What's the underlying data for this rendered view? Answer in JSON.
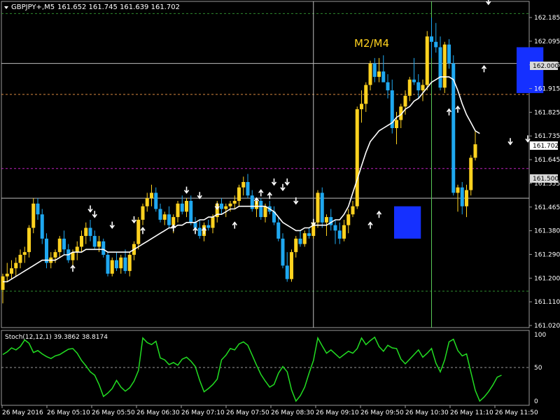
{
  "header": {
    "symbol": "GBPJPY+,M5",
    "ohlc": "161.652 161.745 161.639 161.702"
  },
  "colors": {
    "bull": "#ffd21f",
    "bear": "#1fa8f0",
    "ma": "#ffffff",
    "stoch": "#22dd22",
    "highlight": "#1530ff",
    "grid_green": "#2e8b2e",
    "grid_magenta": "#c020c0",
    "annotation": "#ffd21f"
  },
  "annotation": {
    "text": "M2/M4"
  },
  "price_labels": [
    "162.000",
    "161.702",
    "161.500"
  ],
  "stoch": {
    "title": "Stoch(12,12,1) 39.3862 38.8174",
    "ticks": [
      "100",
      "50",
      "0"
    ]
  },
  "chart_data": [
    {
      "type": "candlestick",
      "ylim": [
        161.02,
        162.23
      ],
      "y_ticks": [
        "162.185",
        "162.095",
        "162.005",
        "161.915",
        "161.825",
        "161.735",
        "161.645",
        "161.555",
        "161.465",
        "161.380",
        "161.290",
        "161.200",
        "161.110",
        "161.020"
      ],
      "x_ticks": [
        "26 May 2016",
        "26 May 05:10",
        "26 May 05:50",
        "26 May 06:30",
        "26 May 07:10",
        "26 May 07:50",
        "26 May 08:30",
        "26 May 09:10",
        "26 May 09:50",
        "26 May 10:30",
        "26 May 11:10",
        "26 May 11:50"
      ],
      "h_levels": [
        {
          "price": 162.185,
          "style": "dashed-green"
        },
        {
          "price": 162.0,
          "style": "solid-gray"
        },
        {
          "price": 161.885,
          "style": "dashed-orange"
        },
        {
          "price": 161.61,
          "style": "dashed-magenta"
        },
        {
          "price": 161.5,
          "style": "solid-gray"
        },
        {
          "price": 161.155,
          "style": "dashed-green"
        }
      ],
      "v_lines": [
        71,
        98
      ],
      "highlight_boxes": [
        {
          "from": 90,
          "to": 95,
          "top": 161.47,
          "bottom": 161.35
        },
        {
          "from": 118,
          "to": 123,
          "top": 162.06,
          "bottom": 161.89
        }
      ],
      "candles": [
        [
          161.16,
          161.22,
          161.11,
          161.21
        ],
        [
          161.21,
          161.26,
          161.19,
          161.22
        ],
        [
          161.22,
          161.27,
          161.2,
          161.24
        ],
        [
          161.24,
          161.28,
          161.21,
          161.26
        ],
        [
          161.26,
          161.31,
          161.24,
          161.29
        ],
        [
          161.29,
          161.32,
          161.26,
          161.3
        ],
        [
          161.3,
          161.4,
          161.28,
          161.39
        ],
        [
          161.39,
          161.5,
          161.37,
          161.48
        ],
        [
          161.48,
          161.5,
          161.42,
          161.44
        ],
        [
          161.44,
          161.46,
          161.33,
          161.35
        ],
        [
          161.35,
          161.37,
          161.24,
          161.26
        ],
        [
          161.26,
          161.3,
          161.24,
          161.28
        ],
        [
          161.28,
          161.31,
          161.26,
          161.3
        ],
        [
          161.3,
          161.36,
          161.28,
          161.35
        ],
        [
          161.35,
          161.38,
          161.29,
          161.31
        ],
        [
          161.31,
          161.33,
          161.26,
          161.27
        ],
        [
          161.27,
          161.31,
          161.25,
          161.3
        ],
        [
          161.3,
          161.34,
          161.27,
          161.32
        ],
        [
          161.32,
          161.38,
          161.3,
          161.36
        ],
        [
          161.36,
          161.41,
          161.33,
          161.39
        ],
        [
          161.39,
          161.42,
          161.34,
          161.36
        ],
        [
          161.36,
          161.38,
          161.31,
          161.32
        ],
        [
          161.32,
          161.36,
          161.3,
          161.34
        ],
        [
          161.34,
          161.35,
          161.28,
          161.29
        ],
        [
          161.29,
          161.3,
          161.21,
          161.22
        ],
        [
          161.22,
          161.28,
          161.21,
          161.27
        ],
        [
          161.27,
          161.3,
          161.23,
          161.24
        ],
        [
          161.24,
          161.29,
          161.22,
          161.28
        ],
        [
          161.28,
          161.31,
          161.22,
          161.23
        ],
        [
          161.23,
          161.3,
          161.21,
          161.29
        ],
        [
          161.29,
          161.34,
          161.27,
          161.33
        ],
        [
          161.33,
          161.43,
          161.31,
          161.42
        ],
        [
          161.42,
          161.48,
          161.4,
          161.47
        ],
        [
          161.47,
          161.52,
          161.45,
          161.5
        ],
        [
          161.5,
          161.55,
          161.47,
          161.52
        ],
        [
          161.52,
          161.54,
          161.45,
          161.46
        ],
        [
          161.46,
          161.48,
          161.41,
          161.42
        ],
        [
          161.42,
          161.45,
          161.4,
          161.44
        ],
        [
          161.44,
          161.47,
          161.39,
          161.4
        ],
        [
          161.4,
          161.44,
          161.37,
          161.43
        ],
        [
          161.43,
          161.49,
          161.41,
          161.48
        ],
        [
          161.48,
          161.51,
          161.44,
          161.45
        ],
        [
          161.45,
          161.5,
          161.43,
          161.49
        ],
        [
          161.49,
          161.51,
          161.4,
          161.41
        ],
        [
          161.41,
          161.43,
          161.38,
          161.39
        ],
        [
          161.39,
          161.42,
          161.35,
          161.36
        ],
        [
          161.36,
          161.41,
          161.34,
          161.4
        ],
        [
          161.4,
          161.42,
          161.38,
          161.39
        ],
        [
          161.39,
          161.44,
          161.37,
          161.43
        ],
        [
          161.43,
          161.49,
          161.41,
          161.48
        ],
        [
          161.48,
          161.5,
          161.44,
          161.46
        ],
        [
          161.46,
          161.48,
          161.43,
          161.47
        ],
        [
          161.47,
          161.49,
          161.45,
          161.48
        ],
        [
          161.48,
          161.51,
          161.46,
          161.49
        ],
        [
          161.49,
          161.55,
          161.47,
          161.54
        ],
        [
          161.54,
          161.58,
          161.51,
          161.56
        ],
        [
          161.56,
          161.59,
          161.5,
          161.51
        ],
        [
          161.51,
          161.53,
          161.45,
          161.46
        ],
        [
          161.46,
          161.5,
          161.43,
          161.49
        ],
        [
          161.49,
          161.5,
          161.42,
          161.43
        ],
        [
          161.43,
          161.48,
          161.41,
          161.47
        ],
        [
          161.47,
          161.49,
          161.44,
          161.45
        ],
        [
          161.45,
          161.47,
          161.4,
          161.41
        ],
        [
          161.41,
          161.43,
          161.34,
          161.35
        ],
        [
          161.35,
          161.37,
          161.24,
          161.25
        ],
        [
          161.25,
          161.3,
          161.19,
          161.2
        ],
        [
          161.2,
          161.31,
          161.19,
          161.3
        ],
        [
          161.3,
          161.36,
          161.28,
          161.35
        ],
        [
          161.35,
          161.38,
          161.32,
          161.33
        ],
        [
          161.33,
          161.38,
          161.32,
          161.37
        ],
        [
          161.37,
          161.39,
          161.35,
          161.36
        ],
        [
          161.36,
          161.42,
          161.35,
          161.41
        ],
        [
          161.41,
          161.53,
          161.39,
          161.52
        ],
        [
          161.52,
          161.54,
          161.39,
          161.41
        ],
        [
          161.41,
          161.44,
          161.36,
          161.43
        ],
        [
          161.43,
          161.46,
          161.38,
          161.4
        ],
        [
          161.4,
          161.42,
          161.33,
          161.38
        ],
        [
          161.38,
          161.41,
          161.33,
          161.35
        ],
        [
          161.35,
          161.42,
          161.34,
          161.4
        ],
        [
          161.4,
          161.46,
          161.37,
          161.44
        ],
        [
          161.44,
          161.49,
          161.43,
          161.47
        ],
        [
          161.47,
          161.84,
          161.46,
          161.83
        ],
        [
          161.83,
          161.9,
          161.78,
          161.85
        ],
        [
          161.85,
          161.93,
          161.82,
          161.92
        ],
        [
          161.92,
          162.01,
          161.9,
          162.0
        ],
        [
          162.0,
          162.02,
          161.93,
          161.95
        ],
        [
          161.95,
          162.02,
          161.93,
          161.97
        ],
        [
          161.97,
          162.03,
          161.94,
          161.93
        ],
        [
          161.93,
          161.96,
          161.87,
          161.9
        ],
        [
          161.9,
          161.94,
          161.74,
          161.76
        ],
        [
          161.76,
          161.82,
          161.7,
          161.79
        ],
        [
          161.79,
          161.85,
          161.76,
          161.84
        ],
        [
          161.84,
          161.9,
          161.81,
          161.88
        ],
        [
          161.88,
          161.95,
          161.86,
          161.94
        ],
        [
          161.94,
          162.02,
          161.92,
          161.93
        ],
        [
          161.93,
          161.96,
          161.87,
          161.9
        ],
        [
          161.9,
          161.94,
          161.86,
          161.92
        ],
        [
          161.92,
          162.12,
          161.9,
          162.1
        ],
        [
          162.1,
          162.17,
          162.02,
          162.08
        ],
        [
          162.08,
          162.15,
          162.04,
          162.06
        ],
        [
          162.06,
          162.1,
          161.9,
          161.91
        ],
        [
          161.91,
          162.08,
          161.89,
          162.07
        ],
        [
          162.07,
          162.09,
          161.98,
          162.0
        ],
        [
          162.0,
          162.03,
          161.51,
          161.52
        ],
        [
          161.52,
          161.55,
          161.45,
          161.54
        ],
        [
          161.54,
          161.56,
          161.44,
          161.47
        ],
        [
          161.47,
          161.55,
          161.43,
          161.53
        ],
        [
          161.53,
          161.66,
          161.51,
          161.65
        ],
        [
          161.65,
          161.75,
          161.64,
          161.7
        ]
      ],
      "moving_average": [
        161.19,
        161.19,
        161.2,
        161.21,
        161.22,
        161.23,
        161.24,
        161.25,
        161.26,
        161.27,
        161.27,
        161.27,
        161.27,
        161.28,
        161.29,
        161.29,
        161.3,
        161.3,
        161.3,
        161.31,
        161.31,
        161.31,
        161.31,
        161.31,
        161.3,
        161.3,
        161.3,
        161.3,
        161.3,
        161.3,
        161.31,
        161.32,
        161.33,
        161.34,
        161.35,
        161.36,
        161.37,
        161.38,
        161.39,
        161.39,
        161.4,
        161.4,
        161.41,
        161.41,
        161.41,
        161.42,
        161.42,
        161.43,
        161.43,
        161.44,
        161.44,
        161.45,
        161.46,
        161.46,
        161.47,
        161.47,
        161.47,
        161.47,
        161.47,
        161.47,
        161.47,
        161.46,
        161.45,
        161.43,
        161.41,
        161.4,
        161.39,
        161.38,
        161.38,
        161.39,
        161.39,
        161.4,
        161.4,
        161.4,
        161.4,
        161.41,
        161.42,
        161.42,
        161.44,
        161.47,
        161.52,
        161.57,
        161.62,
        161.67,
        161.71,
        161.73,
        161.75,
        161.76,
        161.77,
        161.78,
        161.8,
        161.81,
        161.83,
        161.84,
        161.86,
        161.87,
        161.89,
        161.91,
        161.93,
        161.94,
        161.95,
        161.95,
        161.95,
        161.94,
        161.9,
        161.85,
        161.81,
        161.78,
        161.75,
        161.74
      ],
      "up_arrows": [
        [
          16,
          161.24
        ],
        [
          32,
          161.38
        ],
        [
          39,
          161.39
        ],
        [
          44,
          161.38
        ],
        [
          46,
          161.38
        ],
        [
          53,
          161.4
        ],
        [
          58,
          161.49
        ],
        [
          59,
          161.52
        ],
        [
          61,
          161.51
        ],
        [
          84,
          161.4
        ],
        [
          86,
          161.44
        ],
        [
          102,
          161.82
        ],
        [
          104,
          161.83
        ],
        [
          110,
          161.98
        ]
      ],
      "down_arrows": [
        [
          20,
          161.46
        ],
        [
          21,
          161.44
        ],
        [
          25,
          161.4
        ],
        [
          30,
          161.42
        ],
        [
          42,
          161.53
        ],
        [
          45,
          161.51
        ],
        [
          49,
          161.47
        ],
        [
          62,
          161.56
        ],
        [
          64,
          161.54
        ],
        [
          65,
          161.56
        ],
        [
          67,
          161.49
        ],
        [
          71,
          161.41
        ],
        [
          111,
          162.23
        ],
        [
          116,
          161.71
        ],
        [
          120,
          161.72
        ]
      ]
    },
    {
      "type": "line",
      "name": "Stoch",
      "ylim": [
        0,
        100
      ],
      "values": [
        70,
        74,
        80,
        77,
        82,
        92,
        87,
        73,
        76,
        71,
        67,
        64,
        68,
        70,
        74,
        78,
        79,
        72,
        61,
        53,
        44,
        39,
        25,
        7,
        12,
        19,
        31,
        21,
        15,
        20,
        30,
        46,
        95,
        88,
        85,
        90,
        65,
        62,
        55,
        58,
        54,
        63,
        66,
        60,
        52,
        31,
        14,
        19,
        25,
        33,
        62,
        69,
        79,
        77,
        86,
        89,
        84,
        69,
        54,
        40,
        30,
        21,
        25,
        42,
        52,
        44,
        17,
        0,
        8,
        21,
        42,
        61,
        95,
        83,
        72,
        77,
        71,
        65,
        70,
        75,
        72,
        79,
        95,
        85,
        91,
        96,
        82,
        75,
        84,
        80,
        79,
        63,
        56,
        63,
        70,
        77,
        66,
        72,
        79,
        57,
        44,
        62,
        89,
        93,
        76,
        68,
        71,
        43,
        16,
        0,
        6,
        14,
        24,
        36,
        39
      ]
    }
  ]
}
